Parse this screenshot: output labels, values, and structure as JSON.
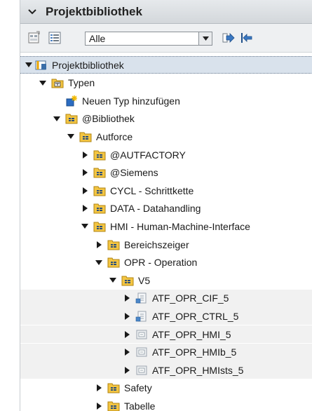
{
  "header": {
    "title": "Projektbibliothek"
  },
  "toolbar": {
    "filter_value": "Alle"
  },
  "tree": [
    {
      "label": "Projektbibliothek",
      "icon": "project-library-icon",
      "twisty": "expanded",
      "level": 0
    },
    {
      "label": "Typen",
      "icon": "types-folder-icon",
      "twisty": "expanded",
      "level": 1
    },
    {
      "label": "Neuen Typ hinzufügen",
      "icon": "add-type-icon",
      "twisty": "none",
      "level": 2
    },
    {
      "label": "@Bibliothek",
      "icon": "type-folder-icon",
      "twisty": "expanded",
      "level": 2
    },
    {
      "label": "Autforce",
      "icon": "type-folder-icon",
      "twisty": "expanded",
      "level": 3
    },
    {
      "label": "@AUTFACTORY",
      "icon": "type-folder-icon",
      "twisty": "collapsed",
      "level": 4
    },
    {
      "label": "@Siemens",
      "icon": "type-folder-icon",
      "twisty": "collapsed",
      "level": 4
    },
    {
      "label": "CYCL - Schrittkette",
      "icon": "type-folder-icon",
      "twisty": "collapsed",
      "level": 4
    },
    {
      "label": "DATA - Datahandling",
      "icon": "type-folder-icon",
      "twisty": "collapsed",
      "level": 4
    },
    {
      "label": "HMI - Human-Machine-Interface",
      "icon": "type-folder-icon",
      "twisty": "expanded",
      "level": 4
    },
    {
      "label": "Bereichszeiger",
      "icon": "type-folder-icon",
      "twisty": "collapsed",
      "level": 5
    },
    {
      "label": "OPR - Operation",
      "icon": "type-folder-icon",
      "twisty": "expanded",
      "level": 5
    },
    {
      "label": "V5",
      "icon": "type-folder-icon",
      "twisty": "expanded",
      "level": 6
    },
    {
      "label": "ATF_OPR_CIF_5",
      "icon": "block-type-icon",
      "twisty": "collapsed",
      "level": 7
    },
    {
      "label": "ATF_OPR_CTRL_5",
      "icon": "block-type-icon",
      "twisty": "collapsed",
      "level": 7
    },
    {
      "label": "ATF_OPR_HMI_5",
      "icon": "udt-type-icon",
      "twisty": "collapsed",
      "level": 7
    },
    {
      "label": "ATF_OPR_HMIb_5",
      "icon": "udt-type-icon",
      "twisty": "collapsed",
      "level": 7
    },
    {
      "label": "ATF_OPR_HMIsts_5",
      "icon": "udt-type-icon",
      "twisty": "collapsed",
      "level": 7
    },
    {
      "label": "Safety",
      "icon": "type-folder-icon",
      "twisty": "collapsed",
      "level": 5
    },
    {
      "label": "Tabelle",
      "icon": "type-folder-icon",
      "twisty": "collapsed",
      "level": 5
    }
  ]
}
